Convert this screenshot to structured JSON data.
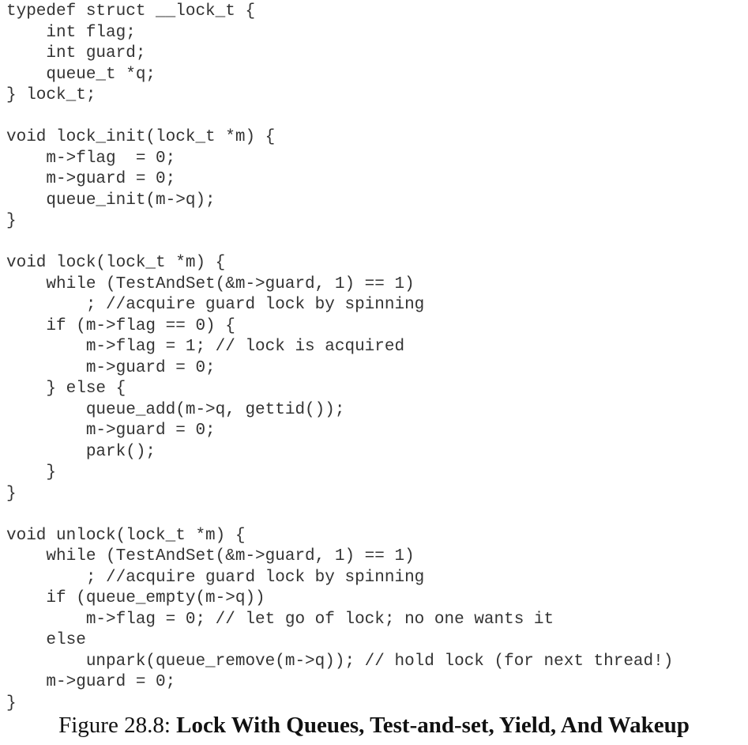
{
  "code_lines": [
    "typedef struct __lock_t {",
    "    int flag;",
    "    int guard;",
    "    queue_t *q;",
    "} lock_t;",
    "",
    "void lock_init(lock_t *m) {",
    "    m->flag  = 0;",
    "    m->guard = 0;",
    "    queue_init(m->q);",
    "}",
    "",
    "void lock(lock_t *m) {",
    "    while (TestAndSet(&m->guard, 1) == 1)",
    "        ; //acquire guard lock by spinning",
    "    if (m->flag == 0) {",
    "        m->flag = 1; // lock is acquired",
    "        m->guard = 0;",
    "    } else {",
    "        queue_add(m->q, gettid());",
    "        m->guard = 0;",
    "        park();",
    "    }",
    "}",
    "",
    "void unlock(lock_t *m) {",
    "    while (TestAndSet(&m->guard, 1) == 1)",
    "        ; //acquire guard lock by spinning",
    "    if (queue_empty(m->q))",
    "        m->flag = 0; // let go of lock; no one wants it",
    "    else",
    "        unpark(queue_remove(m->q)); // hold lock (for next thread!)",
    "    m->guard = 0;",
    "}"
  ],
  "caption": {
    "label": "Figure 28.8:",
    "title": "Lock With Queues, Test-and-set, Yield, And Wakeup"
  }
}
